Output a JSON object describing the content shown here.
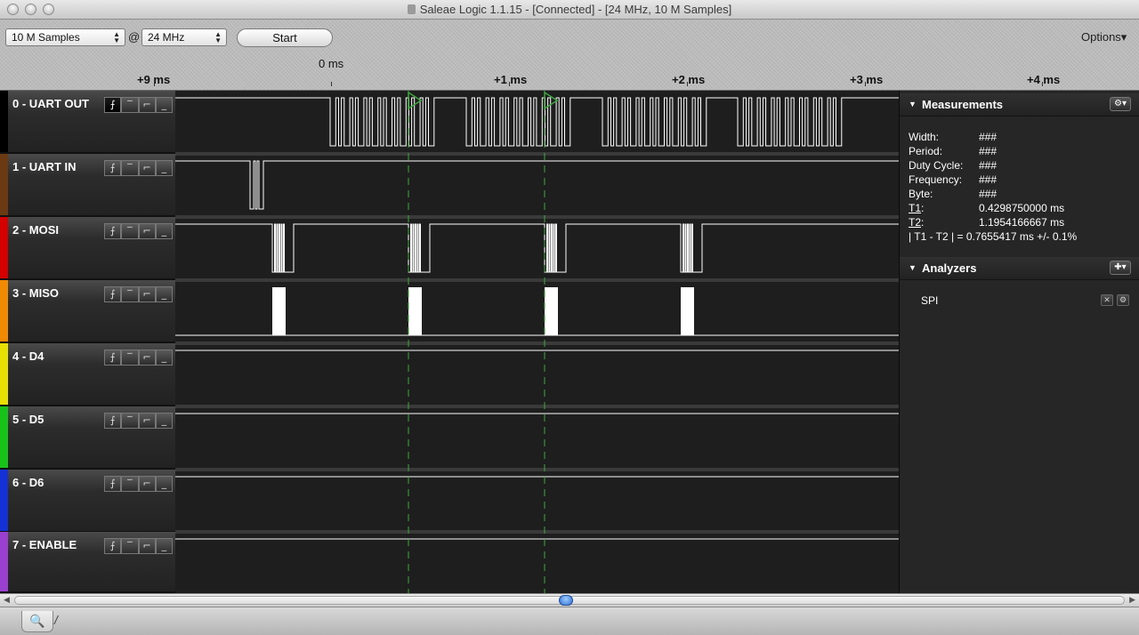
{
  "window": {
    "title": "Saleae Logic 1.1.15 - [Connected] - [24 MHz, 10 M Samples]"
  },
  "toolbar": {
    "samples_value": "10 M Samples",
    "at": "@",
    "rate_value": "24 MHz",
    "start_label": "Start",
    "options_label": "Options▾"
  },
  "timeline": {
    "zero_label": "0 ms",
    "ticks": [
      "+9 ms",
      "+1 ms",
      "+2 ms",
      "+3 ms",
      "+4 ms"
    ]
  },
  "channels": [
    {
      "label": "0 - UART OUT",
      "color": "#000000"
    },
    {
      "label": "1 - UART IN",
      "color": "#6b3a12"
    },
    {
      "label": "2 - MOSI",
      "color": "#d40000"
    },
    {
      "label": "3 - MISO",
      "color": "#f08a00"
    },
    {
      "label": "4 - D4",
      "color": "#e8e000"
    },
    {
      "label": "5 - D5",
      "color": "#19c219"
    },
    {
      "label": "6 - D6",
      "color": "#1431d6"
    },
    {
      "label": "7 - ENABLE",
      "color": "#9b3fd0"
    }
  ],
  "trigger_buttons": [
    "rising-edge",
    "high",
    "falling-edge",
    "low"
  ],
  "trigger_glyphs": [
    "⨍",
    "‾",
    "⌐",
    "_"
  ],
  "measurements": {
    "header": "Measurements",
    "rows": [
      {
        "key": "Width:",
        "value": "###"
      },
      {
        "key": "Period:",
        "value": "###"
      },
      {
        "key": "Duty Cycle:",
        "value": "###"
      },
      {
        "key": "Frequency:",
        "value": "###"
      },
      {
        "key": "Byte:",
        "value": "###"
      }
    ],
    "t1_label": "T1",
    "t1_value": "0.4298750000 ms",
    "t2_label": "T2",
    "t2_value": "1.1954166667 ms",
    "delta": "| T1 - T2 | = 0.7655417 ms +/- 0.1%"
  },
  "analyzers": {
    "header": "Analyzers",
    "items": [
      "SPI"
    ]
  },
  "colors": {
    "trace": "#ffffff",
    "marker": "#3fa63f",
    "background": "#1e1e1e"
  }
}
